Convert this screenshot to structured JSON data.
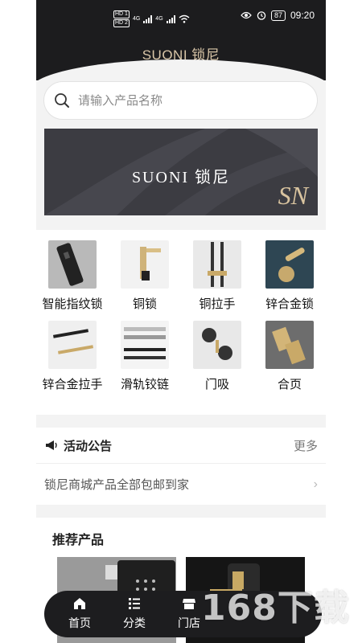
{
  "status_bar": {
    "hd1": "HD 1",
    "hd2": "HD 2",
    "net1": "4G",
    "net2": "4G",
    "battery": "87",
    "time": "09:20",
    "icons": [
      "eye-icon",
      "alarm-icon",
      "wifi-icon",
      "signal-icon"
    ]
  },
  "header": {
    "title": "SUONI 锁尼"
  },
  "search": {
    "placeholder": "请输入产品名称",
    "icon": "search-icon"
  },
  "banner": {
    "text": "SUONI 锁尼",
    "logo": "SN"
  },
  "categories": [
    {
      "label": "智能指纹锁"
    },
    {
      "label": "铜锁"
    },
    {
      "label": "铜拉手"
    },
    {
      "label": "锌合金锁"
    },
    {
      "label": "锌合金拉手"
    },
    {
      "label": "滑轨铰链"
    },
    {
      "label": "门吸"
    },
    {
      "label": "合页"
    }
  ],
  "notice": {
    "title": "活动公告",
    "more": "更多",
    "item": "锁尼商城产品全部包邮到家",
    "icon": "megaphone-icon"
  },
  "recommend": {
    "title": "推荐产品"
  },
  "nav": [
    {
      "label": "首页",
      "icon": "home-icon"
    },
    {
      "label": "分类",
      "icon": "list-icon"
    },
    {
      "label": "门店",
      "icon": "store-icon"
    }
  ],
  "watermark": {
    "text": "168下载"
  },
  "colors": {
    "dark": "#1c1c1e",
    "gold": "#d9c6a8",
    "background": "#f3f3f3"
  }
}
